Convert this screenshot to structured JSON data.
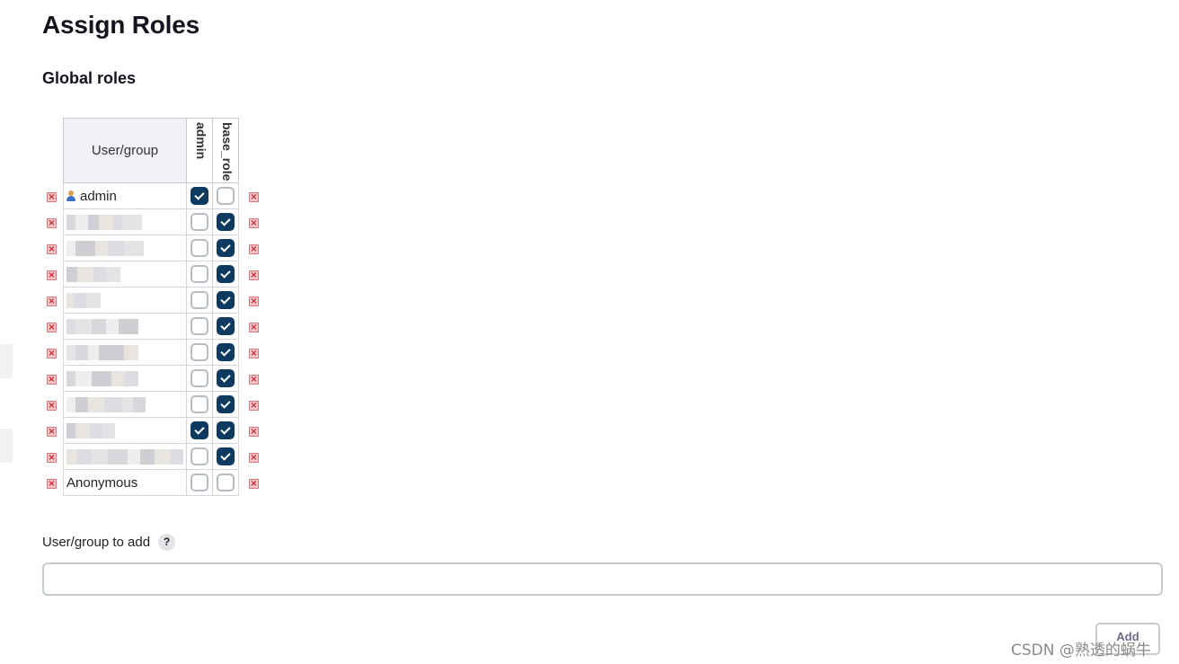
{
  "page": {
    "title": "Assign Roles",
    "section_title": "Global roles"
  },
  "table": {
    "user_header": "User/group",
    "role_columns": [
      "admin",
      "base_role"
    ],
    "rows": [
      {
        "name": "admin",
        "user_icon": "user-icon",
        "admin": true,
        "base_role": false
      },
      {
        "name": "",
        "redacted": true,
        "admin": false,
        "base_role": true
      },
      {
        "name": "",
        "redacted": true,
        "admin": false,
        "base_role": true
      },
      {
        "name": "",
        "redacted": true,
        "admin": false,
        "base_role": true
      },
      {
        "name": "",
        "redacted": true,
        "admin": false,
        "base_role": true
      },
      {
        "name": "",
        "redacted": true,
        "admin": false,
        "base_role": true
      },
      {
        "name": "",
        "redacted": true,
        "admin": false,
        "base_role": true
      },
      {
        "name": "",
        "redacted": true,
        "admin": false,
        "base_role": true
      },
      {
        "name": "",
        "redacted": true,
        "admin": false,
        "base_role": true
      },
      {
        "name": "",
        "redacted": true,
        "admin": true,
        "base_role": true
      },
      {
        "name": "",
        "redacted": true,
        "admin": false,
        "base_role": true
      },
      {
        "name": "Anonymous",
        "admin": false,
        "base_role": false
      }
    ],
    "delete_icon": "delete-x-icon"
  },
  "add_form": {
    "label": "User/group to add",
    "help_glyph": "?",
    "input_value": "",
    "button_label": "Add"
  },
  "watermark": "CSDN @熟透的蜗牛",
  "colors": {
    "checked": "#0f3a60",
    "delete_icon": "#c4262e",
    "header_bg": "#f2f2f6"
  }
}
